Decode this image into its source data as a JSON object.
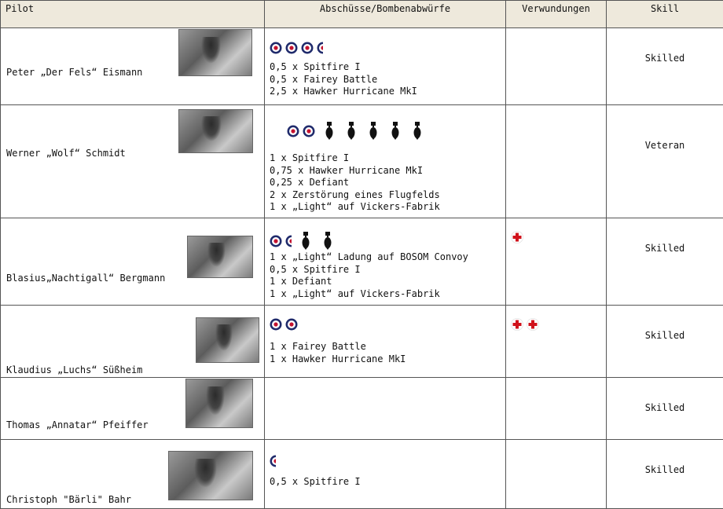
{
  "headers": {
    "pilot": "Pilot",
    "kills": "Abschüsse/Bombenabwürfe",
    "wounds": "Verwundungen",
    "skill": "Skill"
  },
  "rows": [
    {
      "name": "Peter „Der Fels“ Eismann",
      "roundels": 3.5,
      "bombs": 0,
      "wounds": 0,
      "kills": [
        "0,5 x Spitfire I",
        "0,5 x Fairey Battle",
        "2,5 x Hawker Hurricane MkI"
      ],
      "skill": "Skilled"
    },
    {
      "name": "Werner „Wolf“ Schmidt",
      "roundels": 2,
      "bombs": 5,
      "wounds": 0,
      "kills": [
        "1 x Spitfire I",
        "0,75 x Hawker Hurricane MkI",
        "0,25 x Defiant",
        "2 x Zerstörung eines Flugfelds",
        "1 x „Light“ auf Vickers-Fabrik"
      ],
      "skill": "Veteran"
    },
    {
      "name": "Blasius„Nachtigall“ Bergmann",
      "roundels": 1.5,
      "bombs": 2,
      "wounds": 1,
      "kills": [
        "1 x „Light“ Ladung auf BOSOM Convoy",
        "0,5 x Spitfire I",
        "1 x Defiant",
        "1 x „Light“ auf Vickers-Fabrik"
      ],
      "skill": "Skilled"
    },
    {
      "name": "Klaudius „Luchs“ Süßheim",
      "roundels": 2,
      "bombs": 0,
      "wounds": 2,
      "kills": [
        "1 x Fairey Battle",
        "1 x Hawker Hurricane MkI"
      ],
      "skill": "Skilled"
    },
    {
      "name": "Thomas „Annatar“ Pfeiffer",
      "roundels": 0,
      "bombs": 0,
      "wounds": 0,
      "kills": [],
      "skill": "Skilled"
    },
    {
      "name": "Christoph \"Bärli\" Bahr",
      "roundels": 0.5,
      "bombs": 0,
      "wounds": 0,
      "kills": [
        "0,5 x Spitfire I"
      ],
      "skill": "Skilled"
    }
  ],
  "icons": {
    "kill_marker": "raf-roundel-icon",
    "bomb_marker": "bomb-icon",
    "wound_marker": "red-cross-icon"
  },
  "colors": {
    "header_bg": "#eee9dc",
    "roundel_blue": "#1f2a6b",
    "roundel_red": "#c4122f",
    "cross_red": "#d0121b"
  }
}
